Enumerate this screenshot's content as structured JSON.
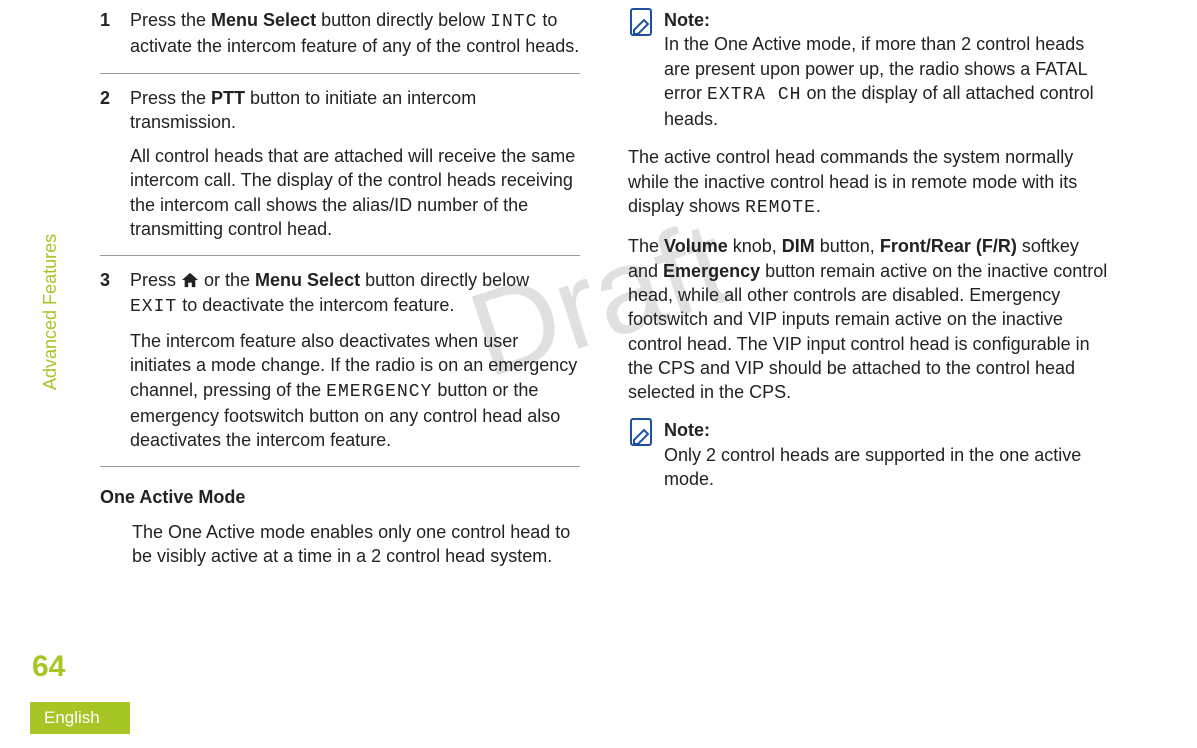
{
  "watermark": "Draft",
  "sidebar": {
    "label": "Advanced Features"
  },
  "page_number": "64",
  "language": "English",
  "left": {
    "steps": [
      {
        "num": "1",
        "parts": [
          {
            "t": "Press the ",
            "k": "plain"
          },
          {
            "t": "Menu Select",
            "k": "bold"
          },
          {
            "t": " button directly below ",
            "k": "plain"
          },
          {
            "t": "INTC",
            "k": "mono"
          },
          {
            "t": " to activate the intercom feature of any of the control heads.",
            "k": "plain"
          }
        ]
      },
      {
        "num": "2",
        "p1": [
          {
            "t": "Press the ",
            "k": "plain"
          },
          {
            "t": "PTT",
            "k": "bold"
          },
          {
            "t": " button to initiate an intercom transmission.",
            "k": "plain"
          }
        ],
        "p2": "All control heads that are attached will receive the same intercom call. The display of the control heads receiving the intercom call shows the alias/ID number of the transmitting control head."
      },
      {
        "num": "3",
        "p1_a": "Press ",
        "p1_b": " or the ",
        "p1_c": "Menu Select",
        "p1_d": " button directly below ",
        "p1_e": "EXIT",
        "p1_f": " to deactivate the intercom feature.",
        "p2_a": "The intercom feature also deactivates when user initiates a mode change. If the radio is on an emergency channel, pressing of the ",
        "p2_b": "EMERGENCY",
        "p2_c": " button or the emergency footswitch button on any control head also deactivates the intercom feature."
      }
    ],
    "heading": "One Active Mode",
    "para": "The One Active mode enables only one control head to be visibly active at a time in a 2 control head system."
  },
  "right": {
    "note1": {
      "title": "Note:",
      "a": "In the One Active mode, if more than 2 control heads are present upon power up, the radio shows a FATAL error ",
      "b": "EXTRA CH",
      "c": " on the display of all attached control heads."
    },
    "para1_a": "The active control head commands the system normally while the inactive control head is in remote mode with its display shows ",
    "para1_b": "REMOTE",
    "para1_c": ".",
    "para2_a": "The ",
    "para2_b": "Volume",
    "para2_c": " knob, ",
    "para2_d": "DIM",
    "para2_e": " button, ",
    "para2_f": "Front/Rear (F/R)",
    "para2_g": " softkey and ",
    "para2_h": "Emergency",
    "para2_i": " button remain active on the inactive control head, while all other controls are disabled. Emergency footswitch and VIP inputs remain active on the inactive control head. The VIP input control head is configurable in the CPS and VIP should be attached to the control head selected in the CPS.",
    "note2": {
      "title": "Note:",
      "body": "Only 2 control heads are supported in the one active mode."
    }
  }
}
